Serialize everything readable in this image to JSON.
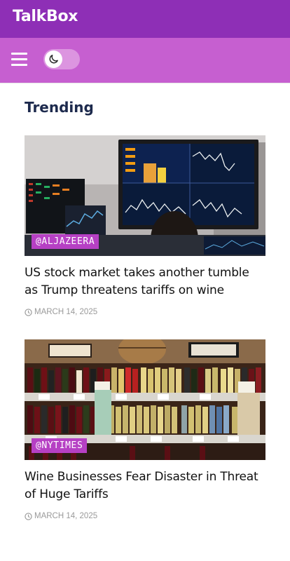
{
  "app": {
    "title": "TalkBox"
  },
  "toolbar": {
    "menu_icon": "hamburger-menu-icon",
    "theme_icon": "moon-icon",
    "dark_mode": false
  },
  "section": {
    "title": "Trending"
  },
  "articles": [
    {
      "source": "@ALJAZEERA",
      "headline": "US stock market takes another tumble as Trump threatens tariffs on wine",
      "date": "MARCH 14, 2025",
      "image": "stock-trading-screens"
    },
    {
      "source": "@NYTIMES",
      "headline": "Wine Businesses Fear Disaster in Threat of Huge Tariffs",
      "date": "MARCH 14, 2025",
      "image": "wine-store-shelves"
    }
  ],
  "colors": {
    "appbar": "#8e2fb6",
    "toolbar": "#c65fd0",
    "badge": "#b640c4",
    "section_title": "#1d2a4d"
  }
}
